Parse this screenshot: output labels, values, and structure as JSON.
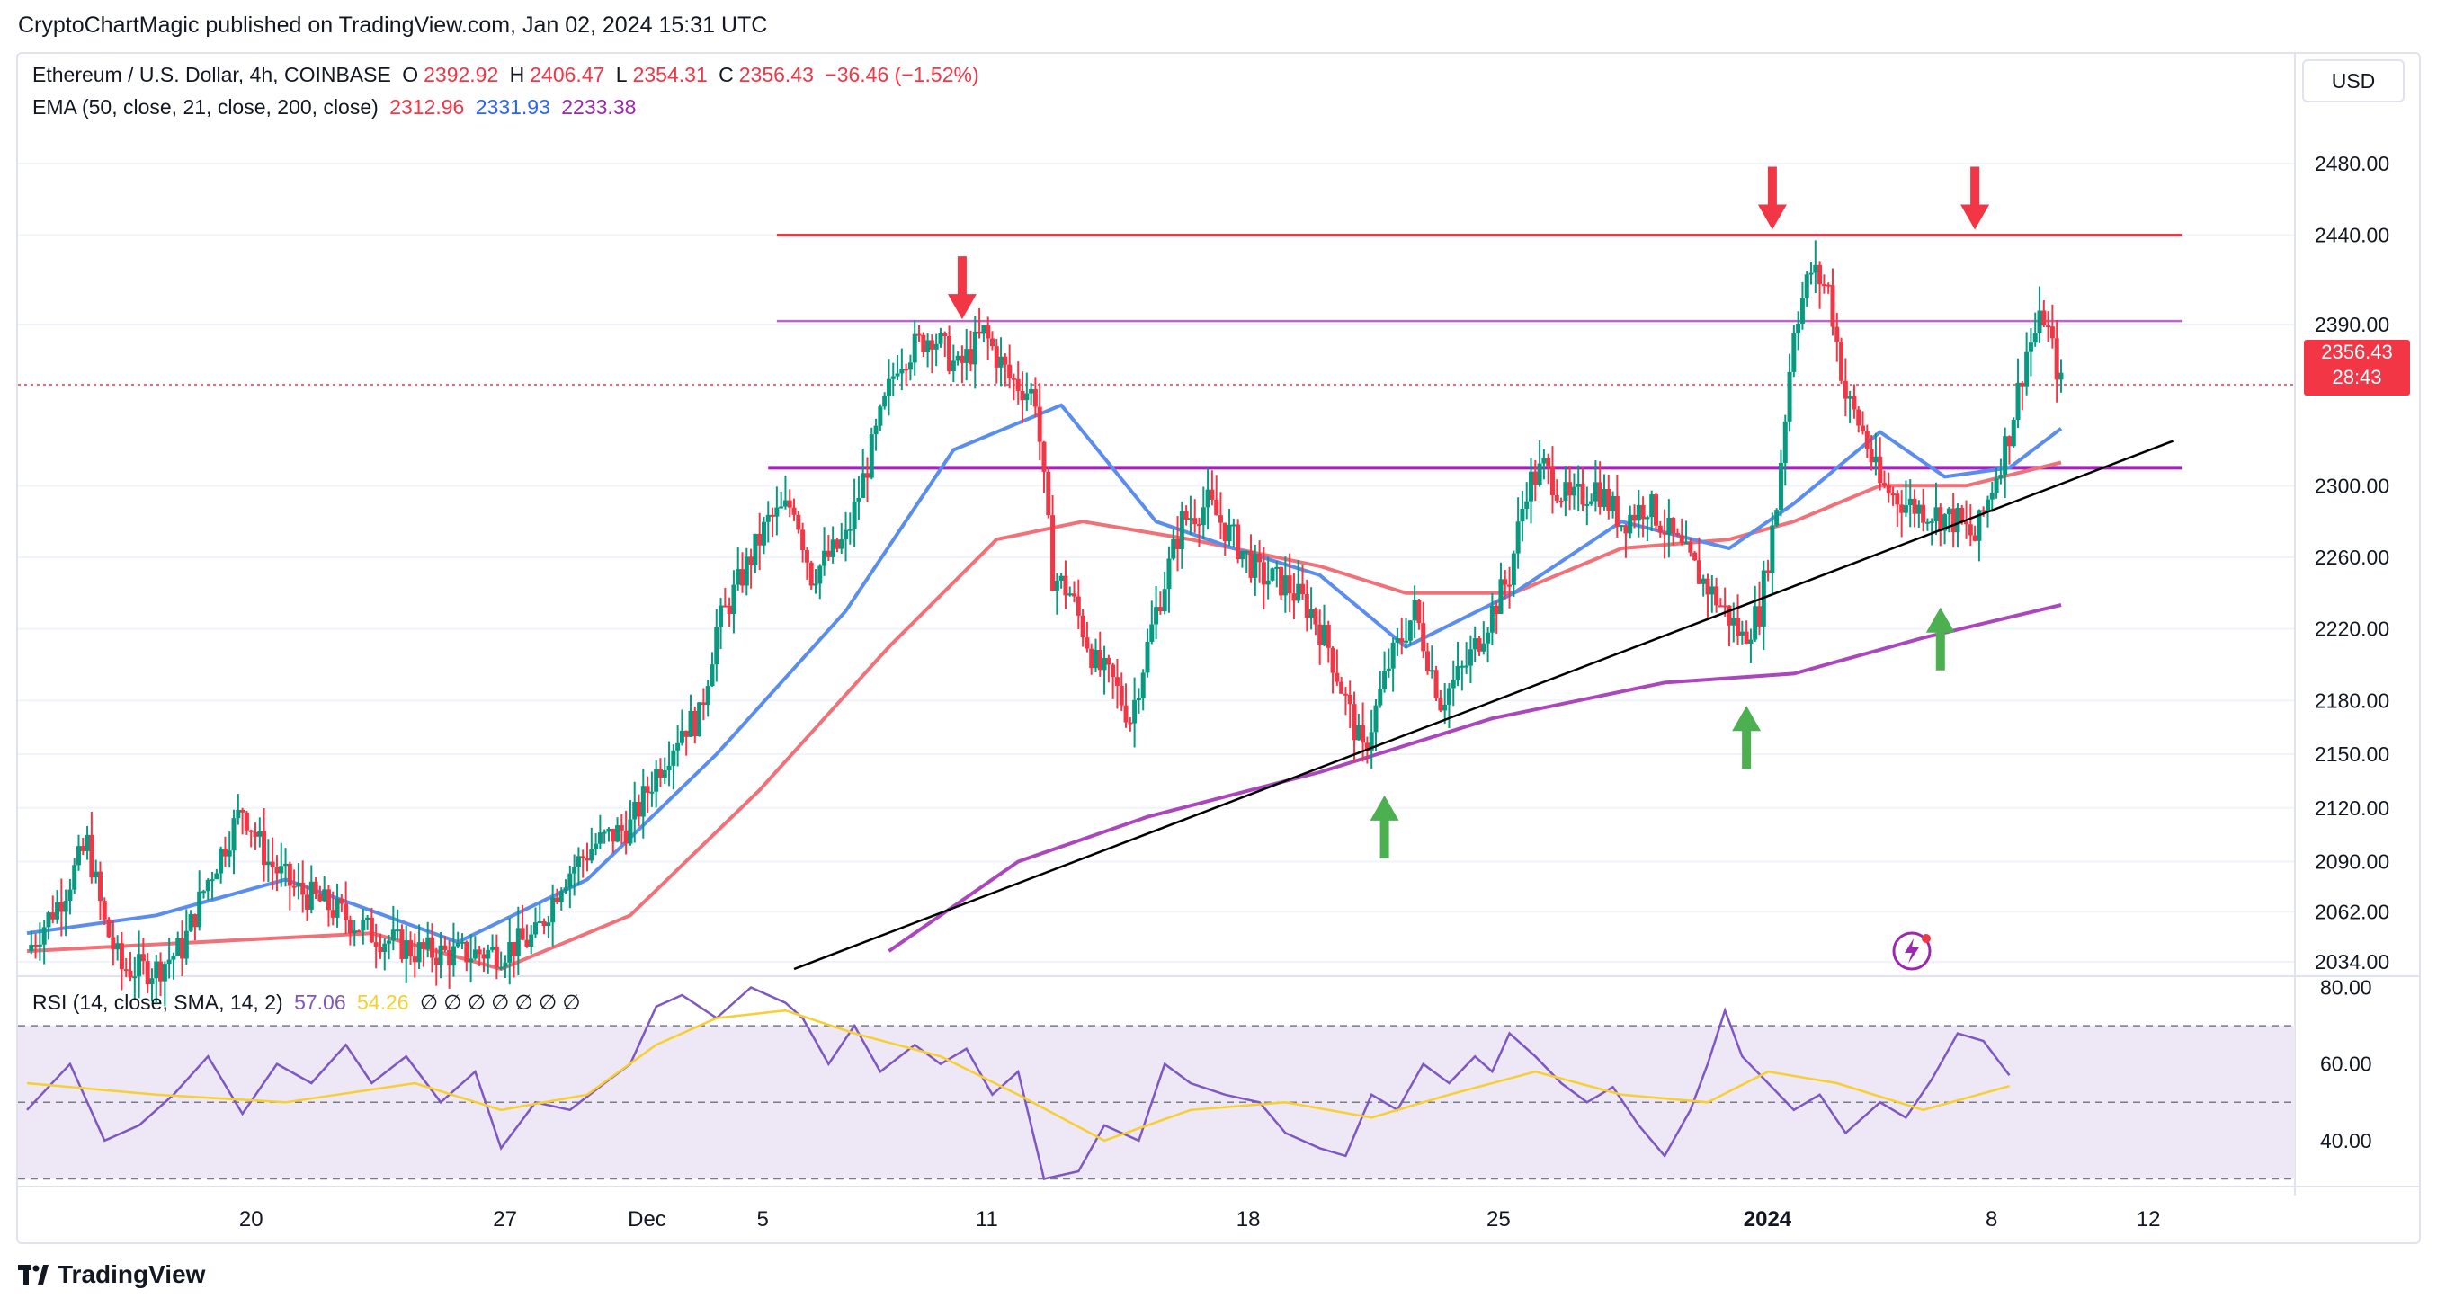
{
  "byline": "CryptoChartMagic published on TradingView.com, Jan 02, 2024 15:31 UTC",
  "legend": {
    "symbol": "Ethereum / U.S. Dollar, 4h, COINBASE",
    "o_label": "O",
    "o": "2392.92",
    "h_label": "H",
    "h": "2406.47",
    "l_label": "L",
    "l": "2354.31",
    "c_label": "C",
    "c": "2356.43",
    "change": "−36.46 (−1.52%)",
    "ema_label": "EMA (50, close, 21, close, 200, close)",
    "ema50": "2312.96",
    "ema21": "2331.93",
    "ema200": "2233.38",
    "rsi_label": "RSI (14, close, SMA, 14, 2)",
    "rsi": "57.06",
    "rsi_sma": "54.26",
    "rsi_na": "∅ ∅ ∅ ∅ ∅ ∅ ∅"
  },
  "currency": "USD",
  "price_badge": {
    "price": "2356.43",
    "countdown": "28:43"
  },
  "footer": "TradingView",
  "colors": {
    "up": "#089981",
    "down": "#f23645",
    "ema50": "#f07178",
    "ema21": "#5b8def",
    "ema200": "#ab47bc",
    "resistance": "#f23645",
    "mid_lines": "#9c27b0",
    "trendline": "#000000",
    "rsi": "#7e57c2",
    "rsi_sma": "#f7cf2e",
    "rsi_band": "#ede7f6"
  },
  "chart_data": [
    {
      "type": "candlestick",
      "title": "Ethereum / U.S. Dollar, 4h, COINBASE",
      "x_ticks": [
        "20",
        "27",
        "Dec",
        "5",
        "11",
        "18",
        "25",
        "2024",
        "8",
        "12"
      ],
      "y_ticks": [
        "2034.00",
        "2062.00",
        "2090.00",
        "2120.00",
        "2150.00",
        "2180.00",
        "2220.00",
        "2260.00",
        "2300.00",
        "2390.00",
        "2440.00",
        "2480.00"
      ],
      "ylim": [
        2028,
        2496
      ],
      "last_price": 2356.43,
      "close_path": [
        [
          0,
          2040
        ],
        [
          8,
          2070
        ],
        [
          14,
          2100
        ],
        [
          18,
          2055
        ],
        [
          22,
          2030
        ],
        [
          30,
          2030
        ],
        [
          36,
          2042
        ],
        [
          42,
          2080
        ],
        [
          50,
          2120
        ],
        [
          56,
          2090
        ],
        [
          62,
          2075
        ],
        [
          70,
          2065
        ],
        [
          80,
          2050
        ],
        [
          90,
          2040
        ],
        [
          100,
          2038
        ],
        [
          110,
          2040
        ],
        [
          118,
          2048
        ],
        [
          124,
          2080
        ],
        [
          132,
          2100
        ],
        [
          140,
          2110
        ],
        [
          146,
          2140
        ],
        [
          152,
          2165
        ],
        [
          156,
          2170
        ],
        [
          160,
          2220
        ],
        [
          166,
          2250
        ],
        [
          172,
          2280
        ],
        [
          178,
          2290
        ],
        [
          182,
          2250
        ],
        [
          190,
          2270
        ],
        [
          196,
          2320
        ],
        [
          202,
          2370
        ],
        [
          210,
          2385
        ],
        [
          216,
          2365
        ],
        [
          222,
          2385
        ],
        [
          228,
          2360
        ],
        [
          234,
          2350
        ],
        [
          238,
          2250
        ],
        [
          242,
          2240
        ],
        [
          248,
          2200
        ],
        [
          252,
          2190
        ],
        [
          256,
          2170
        ],
        [
          262,
          2230
        ],
        [
          268,
          2280
        ],
        [
          274,
          2290
        ],
        [
          280,
          2270
        ],
        [
          286,
          2250
        ],
        [
          292,
          2245
        ],
        [
          298,
          2230
        ],
        [
          302,
          2210
        ],
        [
          306,
          2180
        ],
        [
          310,
          2150
        ],
        [
          316,
          2200
        ],
        [
          322,
          2230
        ],
        [
          328,
          2180
        ],
        [
          334,
          2200
        ],
        [
          340,
          2230
        ],
        [
          344,
          2250
        ],
        [
          348,
          2300
        ],
        [
          352,
          2310
        ],
        [
          358,
          2290
        ],
        [
          364,
          2300
        ],
        [
          370,
          2280
        ],
        [
          376,
          2290
        ],
        [
          382,
          2270
        ],
        [
          388,
          2250
        ],
        [
          394,
          2230
        ],
        [
          398,
          2215
        ],
        [
          402,
          2230
        ],
        [
          406,
          2290
        ],
        [
          410,
          2390
        ],
        [
          414,
          2420
        ],
        [
          418,
          2410
        ],
        [
          422,
          2350
        ],
        [
          426,
          2330
        ],
        [
          430,
          2300
        ],
        [
          436,
          2290
        ],
        [
          442,
          2285
        ],
        [
          448,
          2280
        ],
        [
          452,
          2270
        ],
        [
          456,
          2300
        ],
        [
          460,
          2330
        ],
        [
          464,
          2375
        ],
        [
          468,
          2395
        ],
        [
          472,
          2356.43
        ]
      ],
      "ema21": [
        [
          0,
          2050
        ],
        [
          30,
          2060
        ],
        [
          60,
          2080
        ],
        [
          100,
          2045
        ],
        [
          130,
          2080
        ],
        [
          160,
          2150
        ],
        [
          190,
          2230
        ],
        [
          215,
          2320
        ],
        [
          240,
          2345
        ],
        [
          262,
          2280
        ],
        [
          280,
          2265
        ],
        [
          300,
          2250
        ],
        [
          320,
          2210
        ],
        [
          345,
          2240
        ],
        [
          370,
          2280
        ],
        [
          395,
          2265
        ],
        [
          410,
          2290
        ],
        [
          430,
          2330
        ],
        [
          445,
          2305
        ],
        [
          460,
          2310
        ],
        [
          472,
          2331.93
        ]
      ],
      "ema50": [
        [
          0,
          2040
        ],
        [
          40,
          2045
        ],
        [
          80,
          2050
        ],
        [
          110,
          2030
        ],
        [
          140,
          2060
        ],
        [
          170,
          2130
        ],
        [
          200,
          2210
        ],
        [
          225,
          2270
        ],
        [
          245,
          2280
        ],
        [
          270,
          2270
        ],
        [
          300,
          2255
        ],
        [
          320,
          2240
        ],
        [
          345,
          2240
        ],
        [
          370,
          2265
        ],
        [
          395,
          2270
        ],
        [
          410,
          2280
        ],
        [
          430,
          2300
        ],
        [
          450,
          2300
        ],
        [
          472,
          2312.96
        ]
      ],
      "ema200": [
        [
          200,
          2040
        ],
        [
          230,
          2090
        ],
        [
          260,
          2115
        ],
        [
          300,
          2140
        ],
        [
          340,
          2170
        ],
        [
          380,
          2190
        ],
        [
          410,
          2195
        ],
        [
          440,
          2215
        ],
        [
          472,
          2233.38
        ]
      ],
      "horizontal_levels": [
        {
          "value": 2440,
          "role": "resistance"
        },
        {
          "value": 2392,
          "role": "level"
        },
        {
          "value": 2310,
          "role": "level"
        }
      ],
      "trendline": [
        [
          178,
          2030
        ],
        [
          498,
          2325
        ]
      ],
      "down_arrows": [
        [
          217,
          2390
        ],
        [
          405,
          2440
        ],
        [
          452,
          2440
        ]
      ],
      "up_arrows": [
        [
          315,
          2130
        ],
        [
          399,
          2180
        ],
        [
          444,
          2235
        ]
      ]
    },
    {
      "type": "line",
      "title": "RSI (14, close, SMA, 14, 2)",
      "y_ticks": [
        "40.00",
        "60.00",
        "80.00"
      ],
      "ylim": [
        28,
        82
      ],
      "bands": [
        30,
        50,
        70
      ],
      "series": [
        {
          "values": [
            [
              0,
              48
            ],
            [
              10,
              60
            ],
            [
              18,
              40
            ],
            [
              26,
              44
            ],
            [
              34,
              52
            ],
            [
              42,
              62
            ],
            [
              50,
              47
            ],
            [
              58,
              60
            ],
            [
              66,
              55
            ],
            [
              74,
              65
            ],
            [
              80,
              55
            ],
            [
              88,
              62
            ],
            [
              96,
              50
            ],
            [
              104,
              58
            ],
            [
              110,
              38
            ],
            [
              118,
              50
            ],
            [
              126,
              48
            ],
            [
              134,
              55
            ],
            [
              140,
              60
            ],
            [
              146,
              75
            ],
            [
              152,
              78
            ],
            [
              160,
              72
            ],
            [
              168,
              80
            ],
            [
              176,
              76
            ],
            [
              180,
              72
            ],
            [
              186,
              60
            ],
            [
              192,
              70
            ],
            [
              198,
              58
            ],
            [
              206,
              65
            ],
            [
              212,
              60
            ],
            [
              218,
              64
            ],
            [
              224,
              52
            ],
            [
              230,
              58
            ],
            [
              236,
              30
            ],
            [
              244,
              32
            ],
            [
              250,
              44
            ],
            [
              258,
              40
            ],
            [
              264,
              60
            ],
            [
              270,
              55
            ],
            [
              278,
              52
            ],
            [
              286,
              50
            ],
            [
              292,
              42
            ],
            [
              300,
              38
            ],
            [
              306,
              36
            ],
            [
              312,
              52
            ],
            [
              318,
              48
            ],
            [
              324,
              60
            ],
            [
              330,
              55
            ],
            [
              336,
              62
            ],
            [
              340,
              58
            ],
            [
              344,
              68
            ],
            [
              350,
              62
            ],
            [
              356,
              55
            ],
            [
              362,
              50
            ],
            [
              368,
              54
            ],
            [
              374,
              44
            ],
            [
              380,
              36
            ],
            [
              386,
              48
            ],
            [
              390,
              60
            ],
            [
              394,
              74
            ],
            [
              398,
              62
            ],
            [
              404,
              55
            ],
            [
              410,
              48
            ],
            [
              416,
              52
            ],
            [
              422,
              42
            ],
            [
              430,
              50
            ],
            [
              436,
              46
            ],
            [
              442,
              56
            ],
            [
              448,
              68
            ],
            [
              454,
              66
            ],
            [
              460,
              57.06
            ]
          ]
        },
        {
          "values": [
            [
              0,
              55
            ],
            [
              30,
              52
            ],
            [
              60,
              50
            ],
            [
              90,
              55
            ],
            [
              110,
              48
            ],
            [
              130,
              52
            ],
            [
              146,
              65
            ],
            [
              160,
              72
            ],
            [
              176,
              74
            ],
            [
              192,
              68
            ],
            [
              212,
              62
            ],
            [
              230,
              52
            ],
            [
              250,
              40
            ],
            [
              270,
              48
            ],
            [
              292,
              50
            ],
            [
              312,
              46
            ],
            [
              330,
              52
            ],
            [
              350,
              58
            ],
            [
              370,
              52
            ],
            [
              390,
              50
            ],
            [
              404,
              58
            ],
            [
              420,
              55
            ],
            [
              440,
              48
            ],
            [
              460,
              54.26
            ]
          ]
        }
      ]
    }
  ]
}
